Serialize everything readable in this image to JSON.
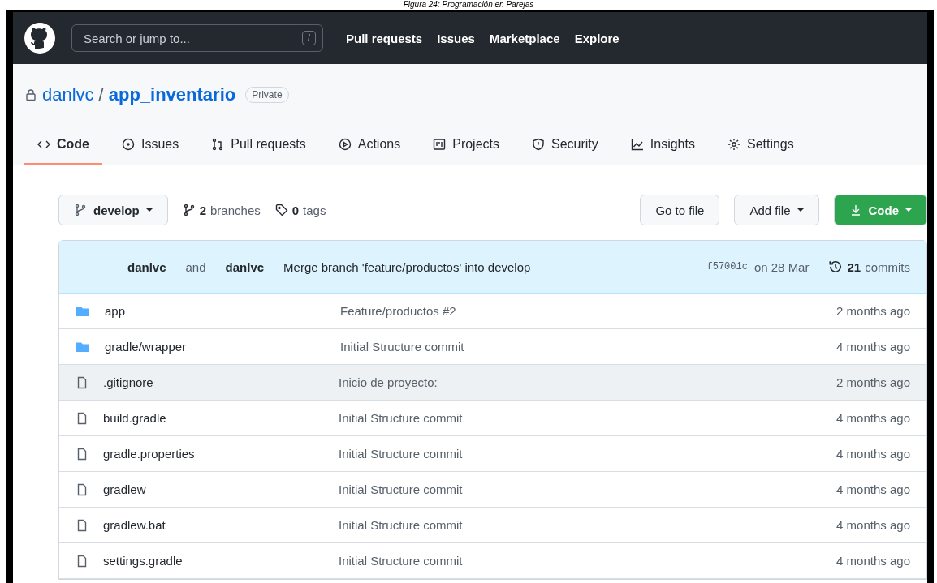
{
  "caption": "Figura 24: Programación en Parejas",
  "header": {
    "search": {
      "placeholder": "Search or jump to...",
      "shortcut": "/"
    },
    "nav": [
      "Pull requests",
      "Issues",
      "Marketplace",
      "Explore"
    ]
  },
  "repo": {
    "owner": "danlvc",
    "separator": "/",
    "name": "app_inventario",
    "visibility": "Private"
  },
  "tabs": [
    {
      "label": "Code",
      "selected": true
    },
    {
      "label": "Issues",
      "selected": false
    },
    {
      "label": "Pull requests",
      "selected": false
    },
    {
      "label": "Actions",
      "selected": false
    },
    {
      "label": "Projects",
      "selected": false
    },
    {
      "label": "Security",
      "selected": false
    },
    {
      "label": "Insights",
      "selected": false
    },
    {
      "label": "Settings",
      "selected": false
    }
  ],
  "toolbar": {
    "branch": "develop",
    "branches_count": "2",
    "branches_label": "branches",
    "tags_count": "0",
    "tags_label": "tags",
    "go_to_file": "Go to file",
    "add_file": "Add file",
    "code": "Code"
  },
  "commit": {
    "author": "danlvc",
    "joiner": "and",
    "coauthor": "danlvc",
    "message": "Merge branch 'feature/productos' into develop",
    "sha": "f57001c",
    "date": "on 28 Mar",
    "count": "21",
    "count_label": "commits"
  },
  "files": [
    {
      "kind": "folder",
      "name": "app",
      "message": "Feature/productos #2",
      "age": "2 months ago",
      "hovered": false
    },
    {
      "kind": "folder",
      "name": "gradle/wrapper",
      "message": "Initial Structure commit",
      "age": "4 months ago",
      "hovered": false
    },
    {
      "kind": "file",
      "name": ".gitignore",
      "message": "Inicio de proyecto:",
      "age": "2 months ago",
      "hovered": true
    },
    {
      "kind": "file",
      "name": "build.gradle",
      "message": "Initial Structure commit",
      "age": "4 months ago",
      "hovered": false
    },
    {
      "kind": "file",
      "name": "gradle.properties",
      "message": "Initial Structure commit",
      "age": "4 months ago",
      "hovered": false
    },
    {
      "kind": "file",
      "name": "gradlew",
      "message": "Initial Structure commit",
      "age": "4 months ago",
      "hovered": false
    },
    {
      "kind": "file",
      "name": "gradlew.bat",
      "message": "Initial Structure commit",
      "age": "4 months ago",
      "hovered": false
    },
    {
      "kind": "file",
      "name": "settings.gradle",
      "message": "Initial Structure commit",
      "age": "4 months ago",
      "hovered": false
    }
  ]
}
